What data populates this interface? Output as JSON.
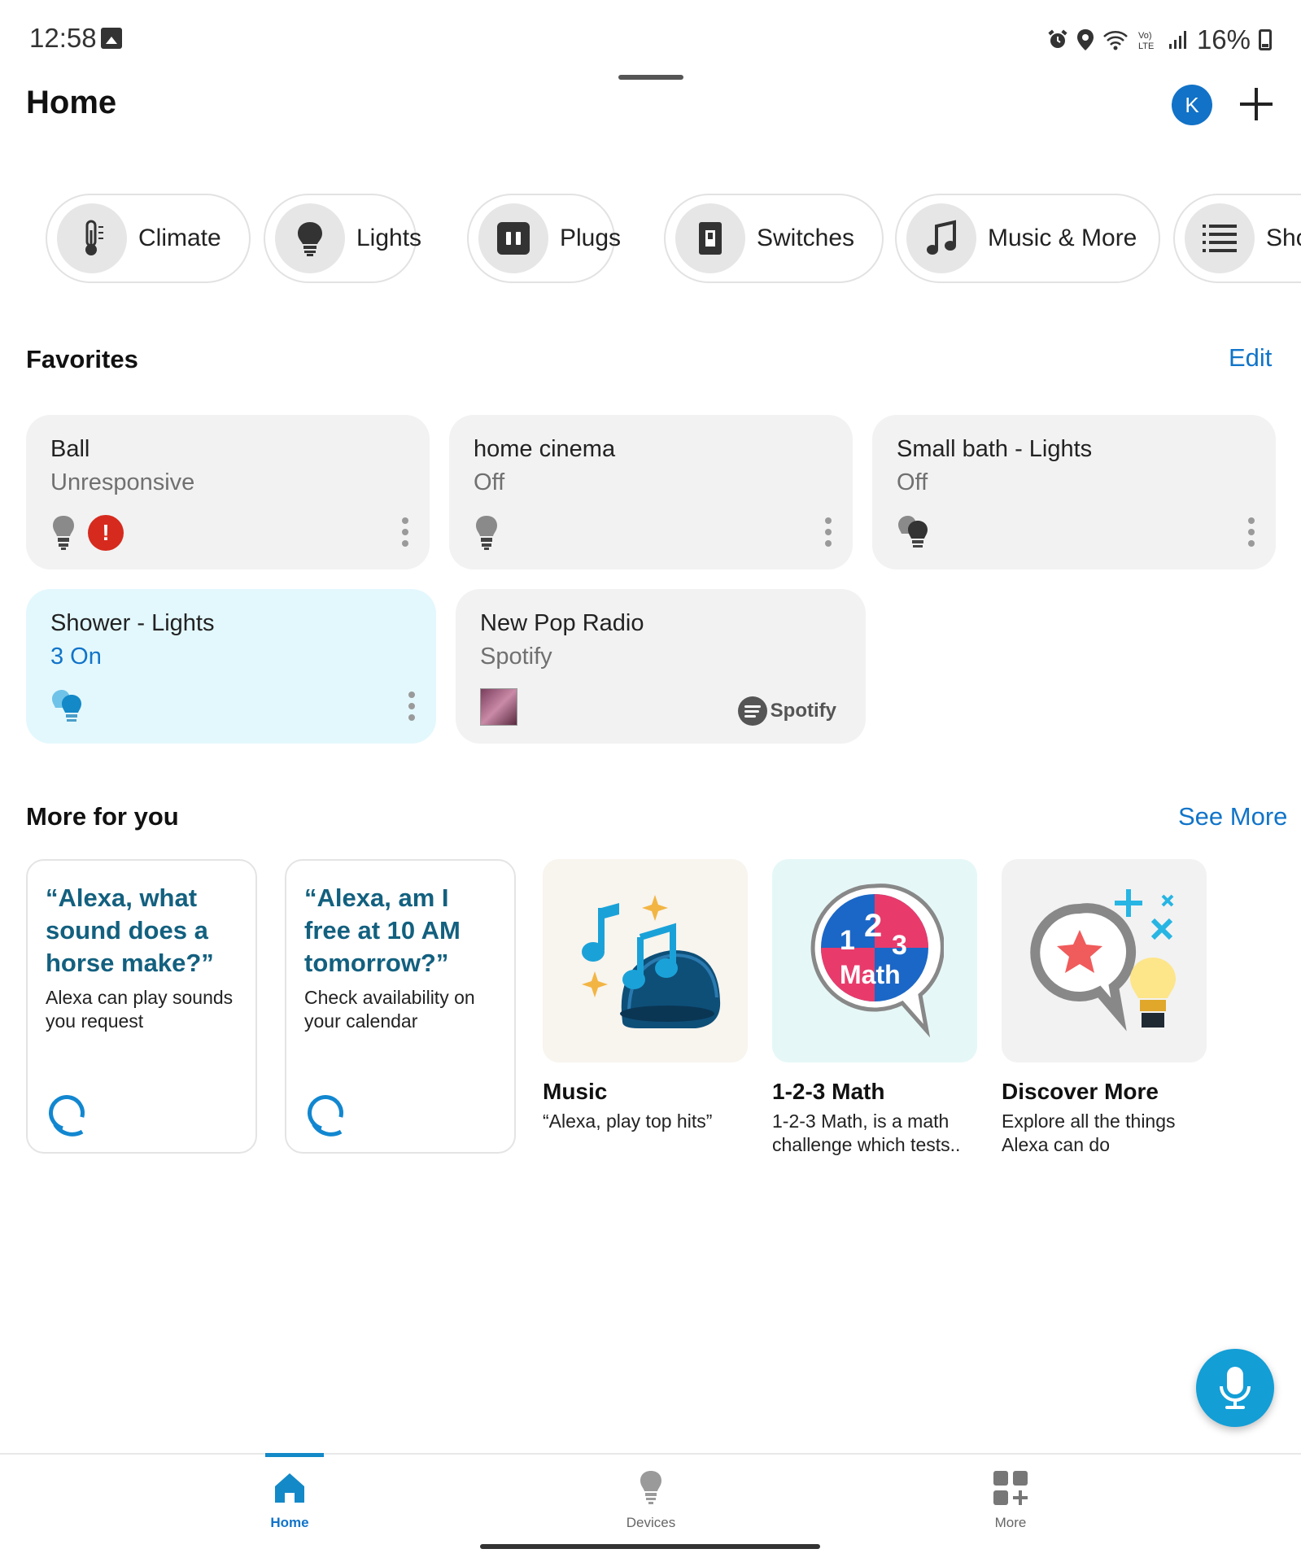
{
  "status_bar": {
    "time": "12:58",
    "battery": "16%",
    "icons": [
      "image-icon",
      "alarm-icon",
      "location-icon",
      "wifi-icon",
      "volte-icon",
      "signal-icon",
      "battery-icon"
    ]
  },
  "header": {
    "title": "Home",
    "avatar_initial": "K"
  },
  "categories": [
    {
      "label": "Climate",
      "icon": "thermometer-icon"
    },
    {
      "label": "Lights",
      "icon": "lightbulb-icon"
    },
    {
      "label": "Plugs",
      "icon": "plug-icon"
    },
    {
      "label": "Switches",
      "icon": "switch-icon"
    },
    {
      "label": "Music & More",
      "icon": "music-note-icon"
    },
    {
      "label": "Sho",
      "icon": "list-icon"
    }
  ],
  "favorites": {
    "title": "Favorites",
    "edit_label": "Edit",
    "items": [
      {
        "name": "Ball",
        "status": "Unresponsive",
        "alert": "!"
      },
      {
        "name": "home cinema",
        "status": "Off"
      },
      {
        "name": "Small bath - Lights",
        "status": "Off"
      },
      {
        "name": "Shower - Lights",
        "status": "3 On"
      },
      {
        "name": "New Pop Radio",
        "status": "Spotify",
        "provider": "Spotify"
      }
    ]
  },
  "more_for_you": {
    "title": "More for you",
    "see_more_label": "See More",
    "tips": [
      {
        "quote": "“Alexa, what sound does a horse make?”",
        "desc": "Alexa can play sounds you request"
      },
      {
        "quote": "“Alexa, am I free at 10 AM tomorrow?”",
        "desc": "Check availability on your calendar"
      }
    ],
    "skills": [
      {
        "title": "Music",
        "desc": "“Alexa, play top hits”",
        "bg": "#f8f4ee"
      },
      {
        "title": "1-2-3 Math",
        "desc": "1-2-3 Math, is a math challenge which tests..",
        "bg": "#e6f7f7",
        "logo_text": "1 2 3 Math"
      },
      {
        "title": "Discover More",
        "desc": "Explore all the things Alexa can do",
        "bg": "#f2f2f2"
      }
    ]
  },
  "bottom_nav": [
    {
      "label": "Home",
      "active": true
    },
    {
      "label": "Devices",
      "active": false
    },
    {
      "label": "More",
      "active": false
    }
  ],
  "colors": {
    "accent": "#1174c9",
    "active_card": "#e3f8fd",
    "mic": "#139ed6",
    "alert": "#d62a1e"
  }
}
